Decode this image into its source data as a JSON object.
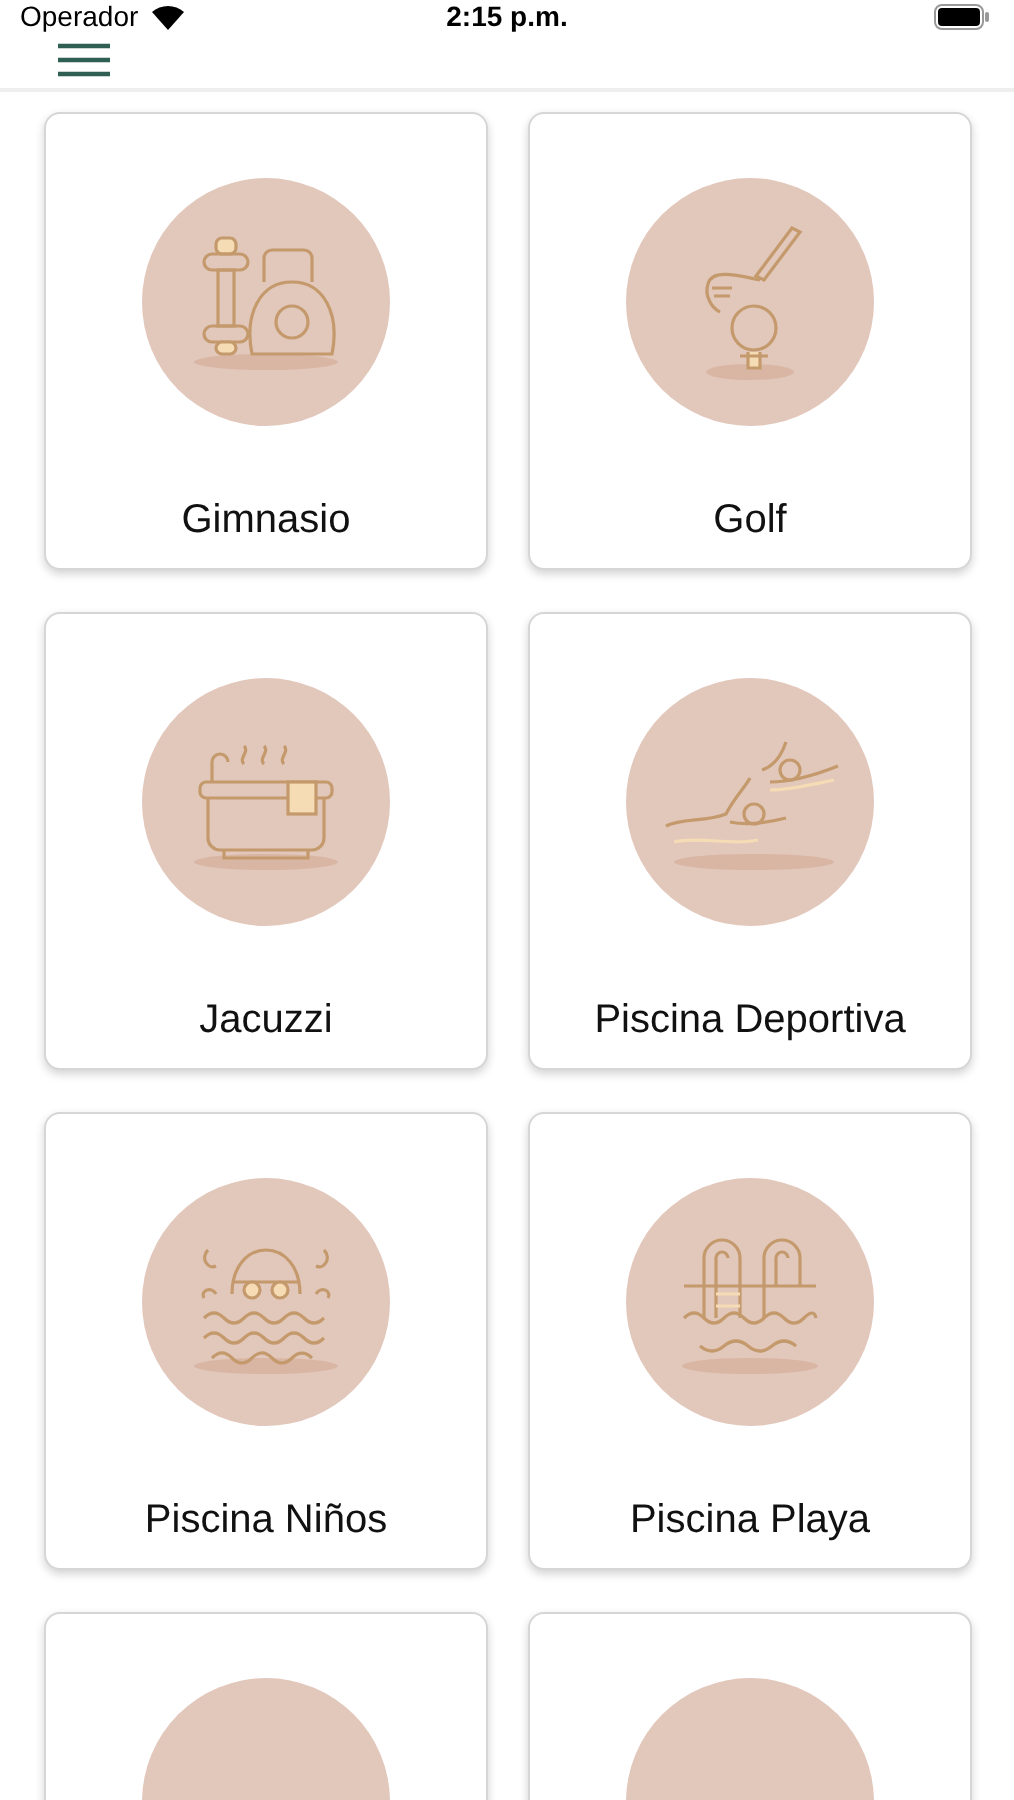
{
  "status_bar": {
    "carrier": "Operador",
    "time": "2:15 p.m."
  },
  "facilities": [
    {
      "label": "Gimnasio",
      "kind": "gym"
    },
    {
      "label": "Golf",
      "kind": "golf"
    },
    {
      "label": "Jacuzzi",
      "kind": "jacuzzi"
    },
    {
      "label": "Piscina Deportiva",
      "kind": "swimmers"
    },
    {
      "label": "Piscina Niños",
      "kind": "swimmer"
    },
    {
      "label": "Piscina Playa",
      "kind": "ladder"
    },
    {
      "kind": "hidden"
    },
    {
      "kind": "hidden"
    }
  ]
}
